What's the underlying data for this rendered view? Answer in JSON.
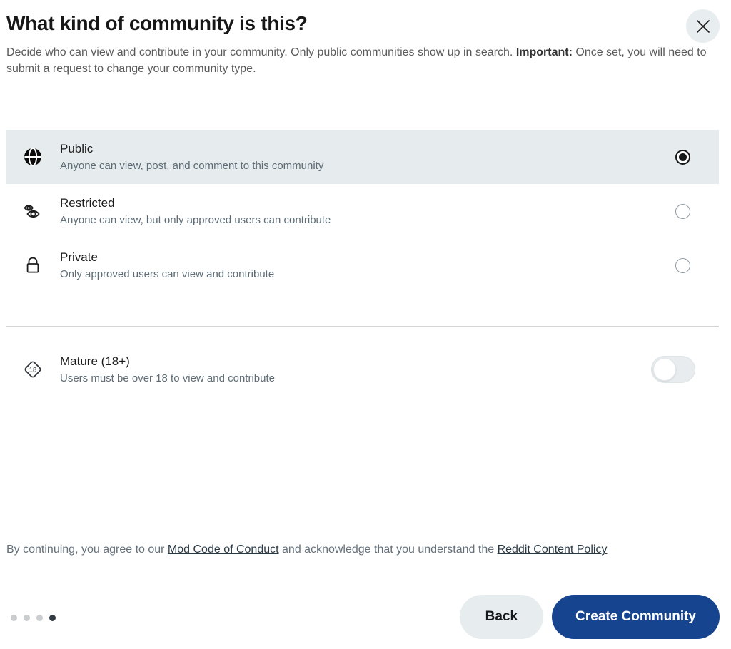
{
  "header": {
    "title": "What kind of community is this?",
    "subtitle_part1": "Decide who can view and contribute in your community. Only public communities show up in search. ",
    "subtitle_bold": "Important:",
    "subtitle_part2": " Once set, you will need to submit a request to change your community type.",
    "close_icon": "close-icon"
  },
  "options": [
    {
      "id": "public",
      "icon": "globe-icon",
      "title": "Public",
      "description": "Anyone can view, post, and comment to this community",
      "selected": true
    },
    {
      "id": "restricted",
      "icon": "eye-restricted-icon",
      "title": "Restricted",
      "description": "Anyone can view, but only approved users can contribute",
      "selected": false
    },
    {
      "id": "private",
      "icon": "lock-icon",
      "title": "Private",
      "description": "Only approved users can view and contribute",
      "selected": false
    }
  ],
  "mature": {
    "icon": "age-18-icon",
    "title": "Mature (18+)",
    "description": "Users must be over 18 to view and contribute",
    "enabled": false
  },
  "legal": {
    "text_part1": "By continuing, you agree to our ",
    "link1": "Mod Code of Conduct",
    "text_part2": " and acknowledge that you understand the ",
    "link2": "Reddit Content Policy"
  },
  "progress": {
    "total_steps": 4,
    "current_step": 4
  },
  "footer": {
    "back_label": "Back",
    "create_label": "Create Community"
  },
  "colors": {
    "primary_button": "#17448e",
    "selected_row": "#e6ebee",
    "title_text": "#171717",
    "description_text": "#5d6c75"
  }
}
